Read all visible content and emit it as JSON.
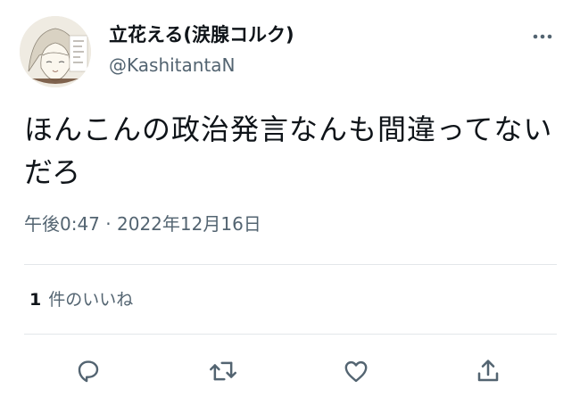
{
  "author": {
    "name": "立花える(涙腺コルク)",
    "handle": "@KashitantaN"
  },
  "tweet": {
    "text": "ほんこんの政治発言なんも間違ってないだろ",
    "time": "午後0:47",
    "separator": "·",
    "date": "2022年12月16日"
  },
  "stats": {
    "likes_count": "1",
    "likes_label": "件のいいね"
  },
  "icons": {
    "more": "more-horizontal-icon",
    "reply": "reply-icon",
    "retweet": "retweet-icon",
    "like": "heart-icon",
    "share": "share-icon"
  },
  "colors": {
    "primary_text": "#0f1419",
    "secondary_text": "#536471",
    "divider": "#e3e7ea"
  }
}
